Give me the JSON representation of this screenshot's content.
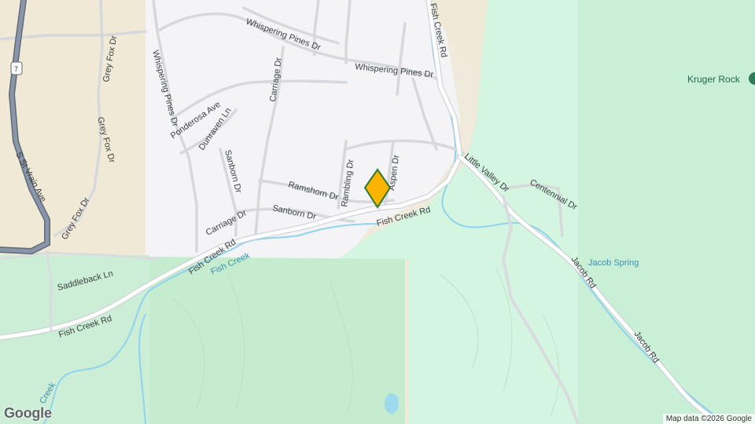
{
  "map": {
    "roads": {
      "whispering_pines_1": "Whispering Pines Dr",
      "whispering_pines_2": "Whispering Pines Dr",
      "whispering_pines_3": "Whispering Pines Dr",
      "grey_fox_1": "Grey Fox Dr",
      "grey_fox_2": "Grey Fox Dr",
      "grey_fox_3": "Grey Fox Dr",
      "ponderosa": "Ponderosa Ave",
      "dunraven": "Dunraven Ln",
      "sanborn_1": "Sanborn Dr",
      "sanborn_2": "Sanborn Dr",
      "carriage_1": "Carriage Dr",
      "carriage_2": "Carriage Dr",
      "ramshorn": "Ramshorn Dr",
      "rambling": "Rambling Dr",
      "aspen": "Aspen Dr",
      "fish_creek_rd_1": "Fish Creek Rd",
      "fish_creek_rd_2": "Fish Creek Rd",
      "fish_creek_rd_3": "Fish Creek Rd",
      "fish_creek_rd_4": "Fish Creek Rd",
      "s_st_vrain": "S St Vrain Ave",
      "little_valley": "Little Valley Dr",
      "centennial": "Centennial Dr",
      "jacob_1": "Jacob Rd",
      "jacob_2": "Jacob Rd",
      "saddleback": "Saddleback Ln"
    },
    "water": {
      "fish_creek_1": "Fish Creek",
      "fish_creek_2": "Creek",
      "jacob_spring": "Jacob Spring"
    },
    "poi": {
      "kruger_rock": "Kruger Rock"
    },
    "route_shield": "7",
    "logo": "Google",
    "attribution": "Map data ©2026 Google"
  }
}
